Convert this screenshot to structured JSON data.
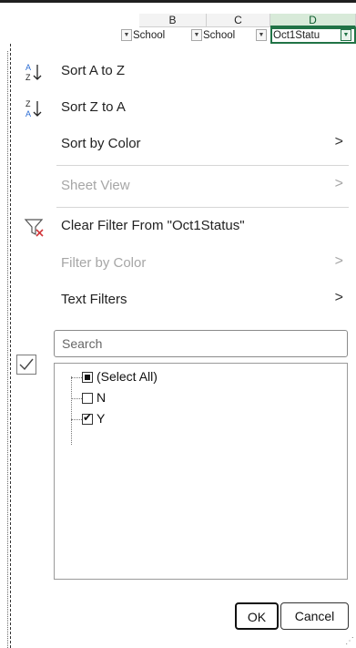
{
  "columns": [
    {
      "letter": "B",
      "header": "School",
      "filter": "dropdown"
    },
    {
      "letter": "C",
      "header": "School",
      "filter": "dropdown"
    },
    {
      "letter": "D",
      "header": "Oct1Statu",
      "filter": "filtered"
    }
  ],
  "menu": {
    "sort_az": {
      "label": "Sort A to Z",
      "icon": "sort-ascending-icon"
    },
    "sort_za": {
      "label": "Sort Z to A",
      "icon": "sort-descending-icon"
    },
    "sort_color": {
      "label": "Sort by Color",
      "arrow": ">"
    },
    "sheet_view": {
      "label": "Sheet View",
      "arrow": ">",
      "disabled": true
    },
    "clear_filter": {
      "label": "Clear Filter From \"Oct1Status\"",
      "icon": "clear-filter-icon"
    },
    "filter_color": {
      "label": "Filter by Color",
      "arrow": ">",
      "disabled": true
    },
    "text_filters": {
      "label": "Text Filters",
      "arrow": ">"
    }
  },
  "search": {
    "placeholder": "Search"
  },
  "list": [
    {
      "label": "(Select All)",
      "state": "partial"
    },
    {
      "label": "N",
      "state": "unchecked"
    },
    {
      "label": "Y",
      "state": "checked"
    }
  ],
  "buttons": {
    "ok": "OK",
    "cancel": "Cancel"
  },
  "colors": {
    "accent": "#217346",
    "disabled": "#a6a6a6"
  }
}
